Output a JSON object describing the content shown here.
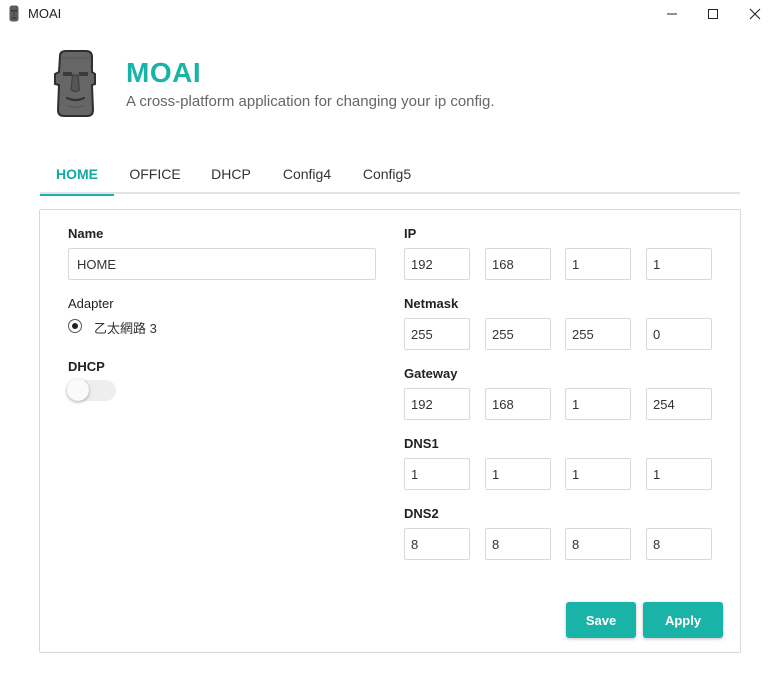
{
  "window": {
    "title": "MOAI",
    "icon": "moai-icon",
    "controls": [
      "minimize-icon",
      "maximize-icon",
      "close-icon"
    ]
  },
  "header": {
    "app_name": "MOAI",
    "description": "A cross-platform application for changing your ip config.",
    "logo": "moai-logo"
  },
  "tabs": [
    {
      "label": "HOME",
      "active": true
    },
    {
      "label": "OFFICE",
      "active": false
    },
    {
      "label": "DHCP",
      "active": false
    },
    {
      "label": "Config4",
      "active": false
    },
    {
      "label": "Config5",
      "active": false
    }
  ],
  "form": {
    "name_label": "Name",
    "name_value": "HOME",
    "adapter_label": "Adapter",
    "adapter_option": "乙太網路 3",
    "adapter_selected": true,
    "dhcp_label": "DHCP",
    "dhcp_enabled": false,
    "ip_label": "IP",
    "ip": [
      "192",
      "168",
      "1",
      "1"
    ],
    "netmask_label": "Netmask",
    "netmask": [
      "255",
      "255",
      "255",
      "0"
    ],
    "gateway_label": "Gateway",
    "gateway": [
      "192",
      "168",
      "1",
      "254"
    ],
    "dns1_label": "DNS1",
    "dns1": [
      "1",
      "1",
      "1",
      "1"
    ],
    "dns2_label": "DNS2",
    "dns2": [
      "8",
      "8",
      "8",
      "8"
    ]
  },
  "actions": {
    "save_label": "Save",
    "apply_label": "Apply"
  },
  "colors": {
    "accent": "#1ab3a8",
    "tab_active": "#14a99e",
    "border": "#d9d9d9"
  }
}
